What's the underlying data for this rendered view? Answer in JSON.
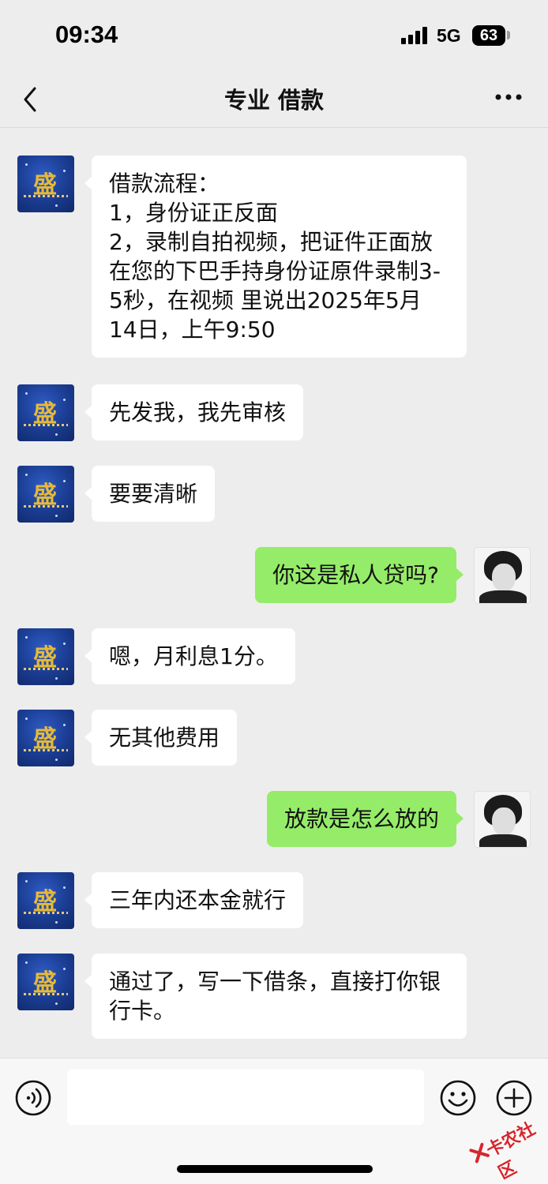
{
  "status_bar": {
    "time": "09:34",
    "network": "5G",
    "battery": "63"
  },
  "nav": {
    "title": "专业  借款",
    "back_icon": "chevron-left-icon",
    "more_icon": "more-dots-icon"
  },
  "messages": [
    {
      "sender": "other",
      "text": "借款流程：\n1，身份证正反面\n2，录制自拍视频，把证件正面放在您的下巴手持身份证原件录制3-5秒，在视频 里说出2025年5月14日，上午9:50"
    },
    {
      "sender": "other",
      "text": "先发我，我先审核"
    },
    {
      "sender": "other",
      "text": "要要清晰"
    },
    {
      "sender": "me",
      "text": "你这是私人贷吗?"
    },
    {
      "sender": "other",
      "text": "嗯，月利息1分。"
    },
    {
      "sender": "other",
      "text": "无其他费用"
    },
    {
      "sender": "me",
      "text": "放款是怎么放的"
    },
    {
      "sender": "other",
      "text": "三年内还本金就行"
    },
    {
      "sender": "other",
      "text": "通过了，写一下借条，直接打你银行卡。"
    }
  ],
  "input_bar": {
    "value": "",
    "voice_icon": "voice-icon",
    "emoji_icon": "emoji-icon",
    "plus_icon": "plus-icon"
  },
  "watermark": {
    "text": "卡农社区"
  },
  "colors": {
    "background": "#ededed",
    "bubble_me": "#95ec69",
    "bubble_other": "#ffffff",
    "watermark": "#d7262d"
  }
}
